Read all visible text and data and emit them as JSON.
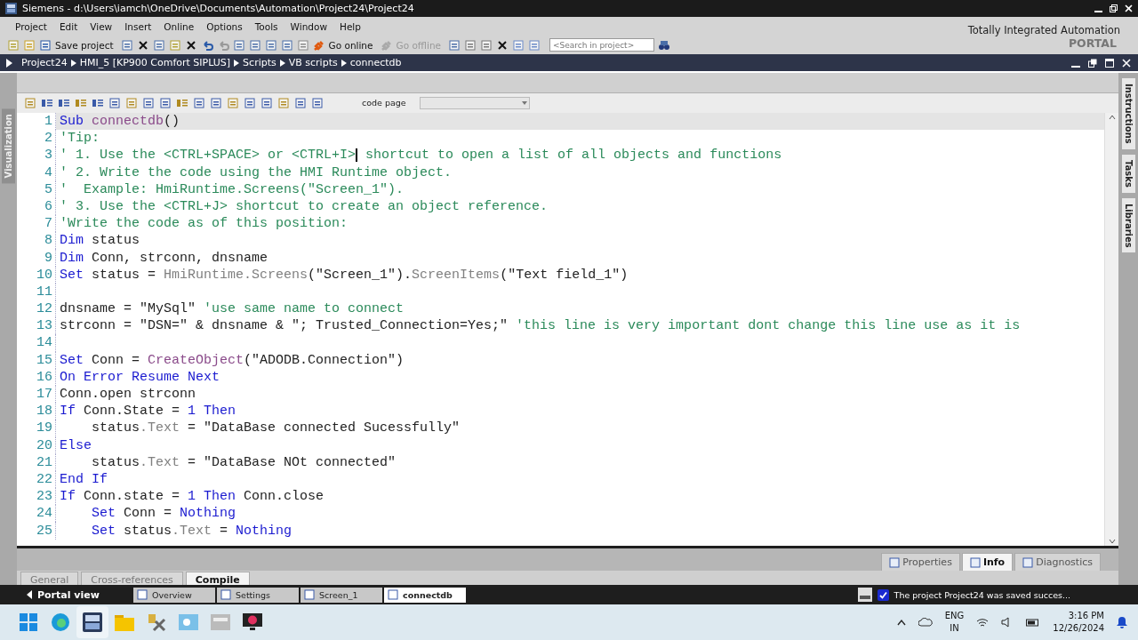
{
  "window": {
    "title": "Siemens  -  d:\\Users\\iamch\\OneDrive\\Documents\\Automation\\Project24\\Project24"
  },
  "menu": [
    "Project",
    "Edit",
    "View",
    "Insert",
    "Online",
    "Options",
    "Tools",
    "Window",
    "Help"
  ],
  "toolbar": {
    "save": "Save project",
    "go_online": {
      "label": "Go online",
      "disabled": false
    },
    "go_offline": {
      "label": "Go offline",
      "disabled": true
    },
    "search": {
      "placeholder": "<Search in project>"
    }
  },
  "brand": {
    "line1": "Totally Integrated Automation",
    "line2": "PORTAL"
  },
  "breadcrumb": [
    "Project24",
    "HMI_5 [KP900 Comfort SIPLUS]",
    "Scripts",
    "VB scripts",
    "connectdb"
  ],
  "left_tabs": [
    "Visualization"
  ],
  "right_tabs": [
    "Instructions",
    "Tasks",
    "Libraries"
  ],
  "editor": {
    "code_page_label": "code page",
    "lines": [
      {
        "number": "1",
        "highlighted": true,
        "tokens": [
          {
            "kind": "kw",
            "text": "Sub "
          },
          {
            "kind": "proc",
            "text": "connectdb"
          },
          {
            "kind": "id",
            "text": "()"
          }
        ]
      },
      {
        "number": "2",
        "highlighted": false,
        "tokens": [
          {
            "kind": "cm",
            "text": "'Tip:"
          }
        ]
      },
      {
        "number": "3",
        "highlighted": false,
        "tokens": [
          {
            "kind": "cm",
            "text": "' 1. Use the <CTRL+SPACE> or <CTRL+I>"
          },
          {
            "kind": "caret"
          },
          {
            "kind": "cm",
            "text": " shortcut to open a list of all objects and functions"
          }
        ]
      },
      {
        "number": "4",
        "highlighted": false,
        "tokens": [
          {
            "kind": "cm",
            "text": "' 2. Write the code using the HMI Runtime object."
          }
        ]
      },
      {
        "number": "5",
        "highlighted": false,
        "tokens": [
          {
            "kind": "cm",
            "text": "'  Example: HmiRuntime.Screens(\"Screen_1\")."
          }
        ]
      },
      {
        "number": "6",
        "highlighted": false,
        "tokens": [
          {
            "kind": "cm",
            "text": "' 3. Use the <CTRL+J> shortcut to create an object reference."
          }
        ]
      },
      {
        "number": "7",
        "highlighted": false,
        "tokens": [
          {
            "kind": "cm",
            "text": "'Write the code as of this position:"
          }
        ]
      },
      {
        "number": "8",
        "highlighted": false,
        "tokens": [
          {
            "kind": "kw",
            "text": "Dim"
          },
          {
            "kind": "id",
            "text": " status"
          }
        ]
      },
      {
        "number": "9",
        "highlighted": false,
        "tokens": [
          {
            "kind": "kw",
            "text": "Dim"
          },
          {
            "kind": "id",
            "text": " Conn, strconn, dnsname"
          }
        ]
      },
      {
        "number": "10",
        "highlighted": false,
        "tokens": [
          {
            "kind": "kw",
            "text": "Set"
          },
          {
            "kind": "id",
            "text": " status = "
          },
          {
            "kind": "fn",
            "text": "HmiRuntime.Screens"
          },
          {
            "kind": "id",
            "text": "(\"Screen_1\")."
          },
          {
            "kind": "fn",
            "text": "ScreenItems"
          },
          {
            "kind": "id",
            "text": "(\"Text field_1\")"
          }
        ]
      },
      {
        "number": "11",
        "highlighted": false
      },
      {
        "number": "12",
        "highlighted": false,
        "tokens": [
          {
            "kind": "id",
            "text": "dnsname = \"MySql\" "
          },
          {
            "kind": "cm",
            "text": "'use same name to connect"
          }
        ]
      },
      {
        "number": "13",
        "highlighted": false,
        "tokens": [
          {
            "kind": "id",
            "text": "strconn = \"DSN=\" & dnsname & \"; Trusted_Connection=Yes;\" "
          },
          {
            "kind": "cm",
            "text": "'this line is very important dont change this line use as it is"
          }
        ]
      },
      {
        "number": "14",
        "highlighted": false
      },
      {
        "number": "15",
        "highlighted": false,
        "tokens": [
          {
            "kind": "kw",
            "text": "Set"
          },
          {
            "kind": "id",
            "text": " Conn = "
          },
          {
            "kind": "proc",
            "text": "CreateObject"
          },
          {
            "kind": "id",
            "text": "(\"ADODB.Connection\")"
          }
        ]
      },
      {
        "number": "16",
        "highlighted": false,
        "tokens": [
          {
            "kind": "kw",
            "text": "On Error Resume Next"
          }
        ]
      },
      {
        "number": "17",
        "highlighted": false,
        "tokens": [
          {
            "kind": "id",
            "text": "Conn.open strconn"
          }
        ]
      },
      {
        "number": "18",
        "highlighted": false,
        "tokens": [
          {
            "kind": "kw",
            "text": "If"
          },
          {
            "kind": "id",
            "text": " Conn.State = "
          },
          {
            "kind": "num",
            "text": "1"
          },
          {
            "kind": "kw",
            "text": " Then"
          }
        ]
      },
      {
        "number": "19",
        "highlighted": false,
        "tokens": [
          {
            "kind": "id",
            "text": "    status"
          },
          {
            "kind": "fn",
            "text": ".Text"
          },
          {
            "kind": "id",
            "text": " = \"DataBase connected Sucessfully\""
          }
        ]
      },
      {
        "number": "20",
        "highlighted": false,
        "tokens": [
          {
            "kind": "kw",
            "text": "Else"
          }
        ]
      },
      {
        "number": "21",
        "highlighted": false,
        "tokens": [
          {
            "kind": "id",
            "text": "    status"
          },
          {
            "kind": "fn",
            "text": ".Text"
          },
          {
            "kind": "id",
            "text": " = \"DataBase NOt connected\""
          }
        ]
      },
      {
        "number": "22",
        "highlighted": false,
        "tokens": [
          {
            "kind": "kw",
            "text": "End If"
          }
        ]
      },
      {
        "number": "23",
        "highlighted": false,
        "tokens": [
          {
            "kind": "kw",
            "text": "If"
          },
          {
            "kind": "id",
            "text": " Conn.state = "
          },
          {
            "kind": "num",
            "text": "1"
          },
          {
            "kind": "kw",
            "text": " Then"
          },
          {
            "kind": "id",
            "text": " Conn.close"
          }
        ]
      },
      {
        "number": "24",
        "highlighted": false,
        "tokens": [
          {
            "kind": "kw",
            "text": "    Set"
          },
          {
            "kind": "id",
            "text": " Conn = "
          },
          {
            "kind": "kw",
            "text": "Nothing"
          }
        ]
      },
      {
        "number": "25",
        "highlighted": false,
        "tokens": [
          {
            "kind": "kw",
            "text": "    Set"
          },
          {
            "kind": "id",
            "text": " status"
          },
          {
            "kind": "fn",
            "text": ".Text"
          },
          {
            "kind": "id",
            "text": " = "
          },
          {
            "kind": "kw",
            "text": "Nothing"
          }
        ]
      }
    ]
  },
  "inspector_tabs": [
    {
      "label": "Properties",
      "selected": false
    },
    {
      "label": "Info",
      "selected": true
    },
    {
      "label": "Diagnostics",
      "selected": false
    }
  ],
  "bottom_tabs": [
    {
      "label": "General",
      "selected": false
    },
    {
      "label": "Cross-references",
      "selected": false
    },
    {
      "label": "Compile",
      "selected": true
    }
  ],
  "portal_bar": {
    "portal_view": "Portal view",
    "tabs": [
      {
        "label": "Overview",
        "selected": false
      },
      {
        "label": "Settings",
        "selected": false
      },
      {
        "label": "Screen_1",
        "selected": false
      },
      {
        "label": "connectdb",
        "selected": true
      }
    ],
    "status": "The project Project24 was saved succes..."
  },
  "taskbar": {
    "language": "ENG",
    "region": "IN",
    "time": "3:16 PM",
    "date": "12/26/2024"
  }
}
